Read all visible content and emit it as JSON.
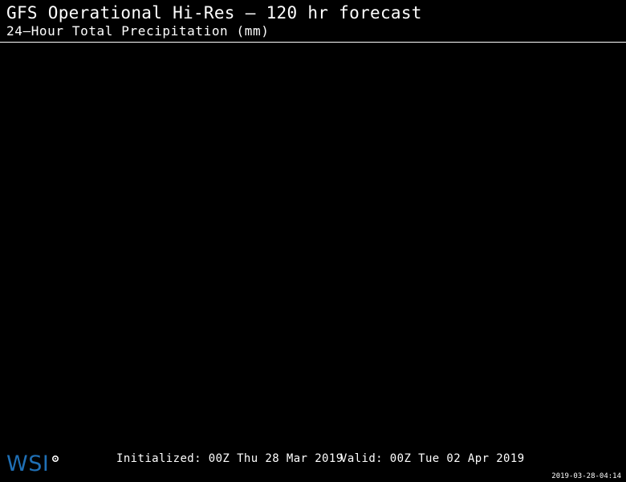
{
  "header": {
    "title": "GFS Operational Hi-Res — 120 hr forecast",
    "subtitle": "24—Hour Total Precipitation (mm)"
  },
  "footer": {
    "logo_text": "WSI",
    "logo_icon": "gear-icon",
    "initialized": "Initialized: 00Z Thu 28 Mar 2019",
    "valid": "Valid: 00Z Tue 02 Apr 2019",
    "timestamp": "2019-03-28-04:14"
  },
  "colors": {
    "background": "#000000",
    "text": "#ffffff",
    "logo": "#1f6fb5"
  }
}
